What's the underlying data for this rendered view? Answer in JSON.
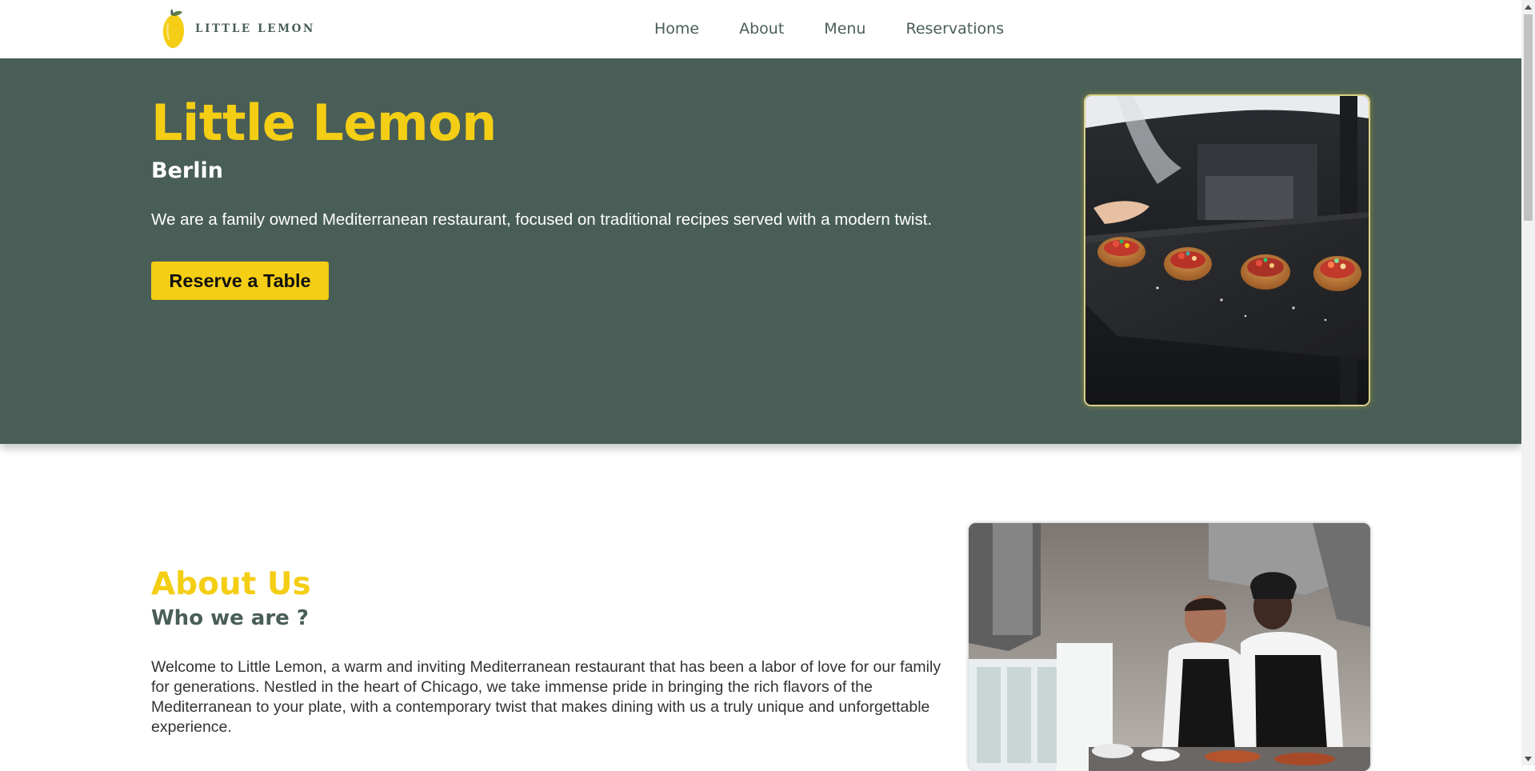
{
  "header": {
    "logo_text": "LITTLE LEMON",
    "nav": [
      {
        "label": "Home"
      },
      {
        "label": "About"
      },
      {
        "label": "Menu"
      },
      {
        "label": "Reservations"
      }
    ]
  },
  "hero": {
    "title": "Little Lemon",
    "subtitle": "Berlin",
    "description": "We are a family owned Mediterranean restaurant, focused on traditional recipes served with a modern twist.",
    "cta_label": "Reserve a Table",
    "image_alt": "Waiter serving bruschetta on a slate board"
  },
  "about": {
    "title": "About Us",
    "subtitle": "Who we are ?",
    "text": "Welcome to Little Lemon, a warm and inviting Mediterranean restaurant that has been a labor of love for our family for generations. Nestled in the heart of Chicago, we take immense pride in bringing the rich flavors of the Mediterranean to your plate, with a contemporary twist that makes dining with us a truly unique and unforgettable experience.",
    "image_alt": "Two chefs preparing food in the kitchen"
  },
  "colors": {
    "primary_green": "#495e57",
    "primary_yellow": "#f4ce14",
    "text_dark": "#333333"
  },
  "icons": {
    "logo": "lemon-icon",
    "scroll_up": "chevron-up-icon",
    "scroll_down": "chevron-down-icon"
  }
}
